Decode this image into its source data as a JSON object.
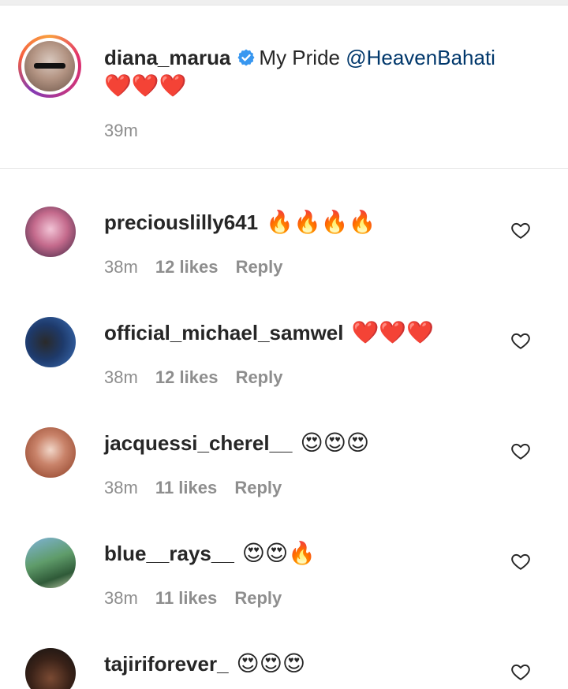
{
  "caption": {
    "username": "diana_marua",
    "verified": true,
    "text": "My Pride",
    "mention": "@HeavenBahati",
    "emoji": "❤️❤️❤️",
    "time": "39m"
  },
  "comments": [
    {
      "username": "preciouslilly641",
      "text": "🔥🔥🔥🔥",
      "time": "38m",
      "likes": "12 likes",
      "reply": "Reply"
    },
    {
      "username": "official_michael_samwel",
      "text": "❤️❤️❤️",
      "time": "38m",
      "likes": "12 likes",
      "reply": "Reply"
    },
    {
      "username": "jacquessi_cherel__",
      "text": "😍😍😍",
      "time": "38m",
      "likes": "11 likes",
      "reply": "Reply"
    },
    {
      "username": "blue__rays__",
      "text": "😍😍🔥",
      "time": "38m",
      "likes": "11 likes",
      "reply": "Reply"
    },
    {
      "username": "tajiriforever_",
      "text": "😍😍😍",
      "time": "",
      "likes": "",
      "reply": ""
    }
  ],
  "colors": {
    "mention": "#00376b",
    "verified": "#3897f0",
    "meta": "#8e8e8e"
  },
  "icons": {
    "like": "heart-outline-icon",
    "verified": "verified-badge-icon"
  }
}
